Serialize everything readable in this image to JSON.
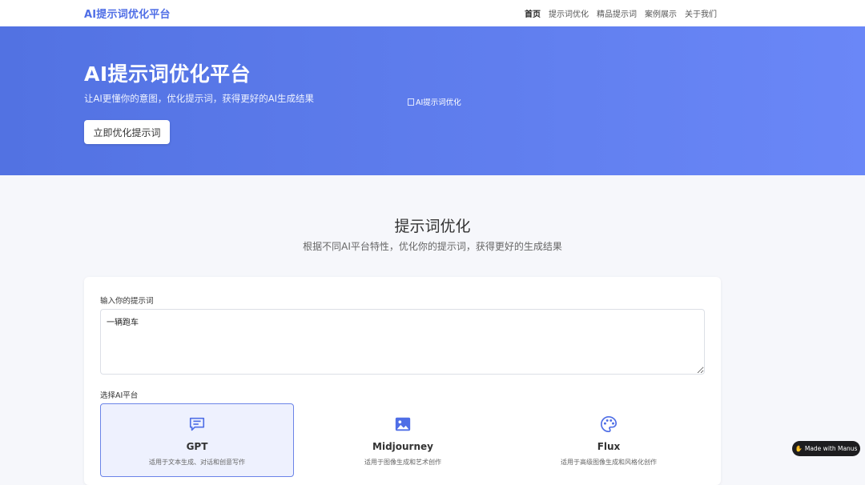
{
  "header": {
    "brand": "AI提示词优化平台",
    "nav": [
      "首页",
      "提示词优化",
      "精品提示词",
      "案例展示",
      "关于我们"
    ]
  },
  "hero": {
    "title": "AI提示词优化平台",
    "subtitle": "让AI更懂你的意图，优化提示词，获得更好的AI生成结果",
    "cta": "立即优化提示词",
    "image_alt": "AI提示词优化"
  },
  "section": {
    "title": "提示词优化",
    "subtitle": "根据不同AI平台特性，优化你的提示词，获得更好的生成结果"
  },
  "form": {
    "prompt_label": "输入你的提示词",
    "prompt_value": "一辆跑车",
    "platform_label": "选择AI平台",
    "platforms": [
      {
        "name": "GPT",
        "desc": "适用于文本生成、对话和创意写作",
        "icon": "chat-icon",
        "selected": true
      },
      {
        "name": "Midjourney",
        "desc": "适用于图像生成和艺术创作",
        "icon": "image-icon",
        "selected": false
      },
      {
        "name": "Flux",
        "desc": "适用于高级图像生成和风格化创作",
        "icon": "palette-icon",
        "selected": false
      }
    ]
  },
  "badge": "Made with Manus",
  "colors": {
    "accent": "#4f6ee6",
    "hero_start": "#5272e2",
    "hero_end": "#6a87f7",
    "selected_border": "#6b84e8"
  }
}
